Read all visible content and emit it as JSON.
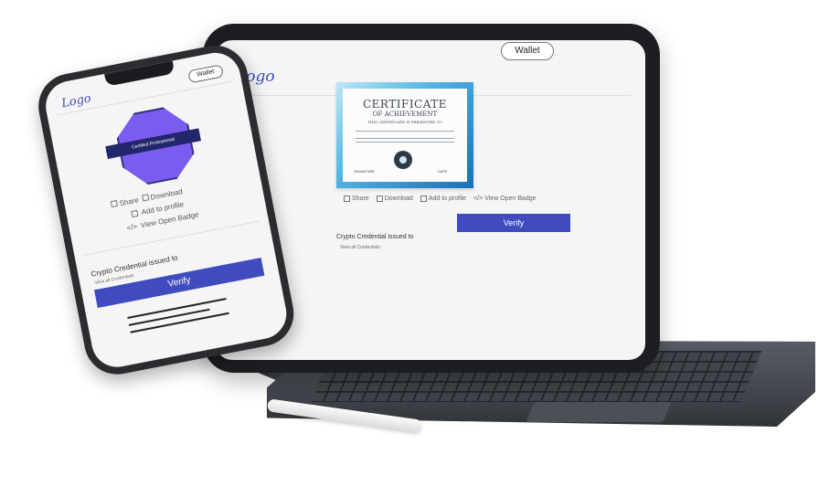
{
  "tablet": {
    "logo": "Logo",
    "wallet_label": "Wallet",
    "certificate": {
      "title": "CERTIFICATE",
      "subtitle": "OF ACHIEVEMENT",
      "presented": "THIS CERTIFICATE IS PRESENTED TO",
      "signature_label": "SIGNATURE",
      "date_label": "DATE"
    },
    "actions": {
      "share": "Share",
      "download": "Download",
      "add_to_profile": "Add to profile",
      "view_open_badge": "View Open Badge"
    },
    "issued_to": "Crypto Credential issued to",
    "view_all": "View all Credentials",
    "verify": "Verify"
  },
  "phone": {
    "logo": "Logo",
    "wallet_label": "Wallet",
    "badge_label": "Certified Professional",
    "actions": {
      "share": "Share",
      "download": "Download",
      "add_to_profile": "Add to profile",
      "view_open_badge": "View Open Badge"
    },
    "issued_to": "Crypto Credential issued to",
    "view_all": "View all Credentials",
    "verify": "Verify"
  },
  "colors": {
    "accent": "#3f4bbf",
    "badge": "#7b5cf0",
    "device_frame": "#1d1e21"
  }
}
